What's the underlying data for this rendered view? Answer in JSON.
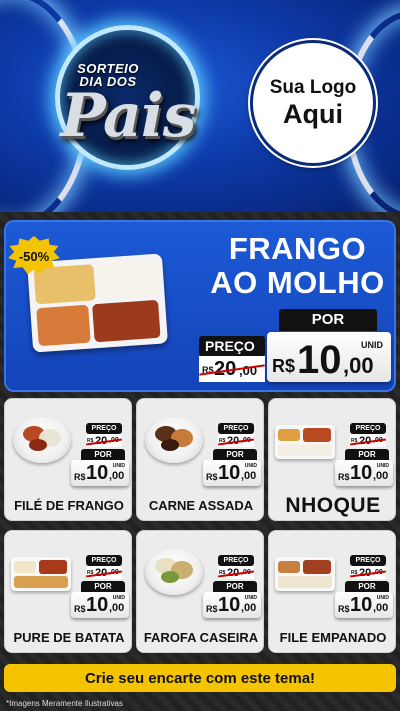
{
  "header": {
    "event_small": "SORTEIO DIA DOS",
    "event_big": "Pais",
    "logo_line1": "Sua Logo",
    "logo_line2": "Aqui"
  },
  "featured": {
    "discount": "-50%",
    "title_line1": "FRANGO",
    "title_line2": "AO MOLHO",
    "preco_label": "PREÇO",
    "por_label": "POR",
    "unid_label": "UNID",
    "old_currency": "R$",
    "old_int": "20",
    "old_dec": ",00",
    "new_currency": "R$",
    "new_int": "10",
    "new_dec": ",00"
  },
  "products": [
    {
      "name": "FILÉ DE FRANGO",
      "preco_label": "PREÇO",
      "old_currency": "R$",
      "old_int": "20",
      "old_dec": ",00",
      "por_label": "POR",
      "unid_label": "UNID",
      "new_currency": "R$",
      "new_int": "10",
      "new_dec": ",00"
    },
    {
      "name": "CARNE ASSADA",
      "preco_label": "PREÇO",
      "old_currency": "R$",
      "old_int": "20",
      "old_dec": ",00",
      "por_label": "POR",
      "unid_label": "UNID",
      "new_currency": "R$",
      "new_int": "10",
      "new_dec": ",00"
    },
    {
      "name": "NHOQUE",
      "preco_label": "PREÇO",
      "old_currency": "R$",
      "old_int": "20",
      "old_dec": ",00",
      "por_label": "POR",
      "unid_label": "UNID",
      "new_currency": "R$",
      "new_int": "10",
      "new_dec": ",00"
    },
    {
      "name": "PURE DE BATATA",
      "preco_label": "PREÇO",
      "old_currency": "R$",
      "old_int": "20",
      "old_dec": ",00",
      "por_label": "POR",
      "unid_label": "UNID",
      "new_currency": "R$",
      "new_int": "10",
      "new_dec": ",00"
    },
    {
      "name": "FAROFA CASEIRA",
      "preco_label": "PREÇO",
      "old_currency": "R$",
      "old_int": "20",
      "old_dec": ",00",
      "por_label": "POR",
      "unid_label": "UNID",
      "new_currency": "R$",
      "new_int": "10",
      "new_dec": ",00"
    },
    {
      "name": "FILE EMPANADO",
      "preco_label": "PREÇO",
      "old_currency": "R$",
      "old_int": "20",
      "old_dec": ",00",
      "por_label": "POR",
      "unid_label": "UNID",
      "new_currency": "R$",
      "new_int": "10",
      "new_dec": ",00"
    }
  ],
  "cta": {
    "label": "Crie seu encarte com este tema!"
  },
  "disclaimer": "*Imagens Meramente Ilustrativas",
  "colors": {
    "header_blue": "#0d3aa8",
    "featured_blue": "#1c5ad6",
    "accent_yellow": "#f5c400",
    "price_black": "#111111"
  }
}
